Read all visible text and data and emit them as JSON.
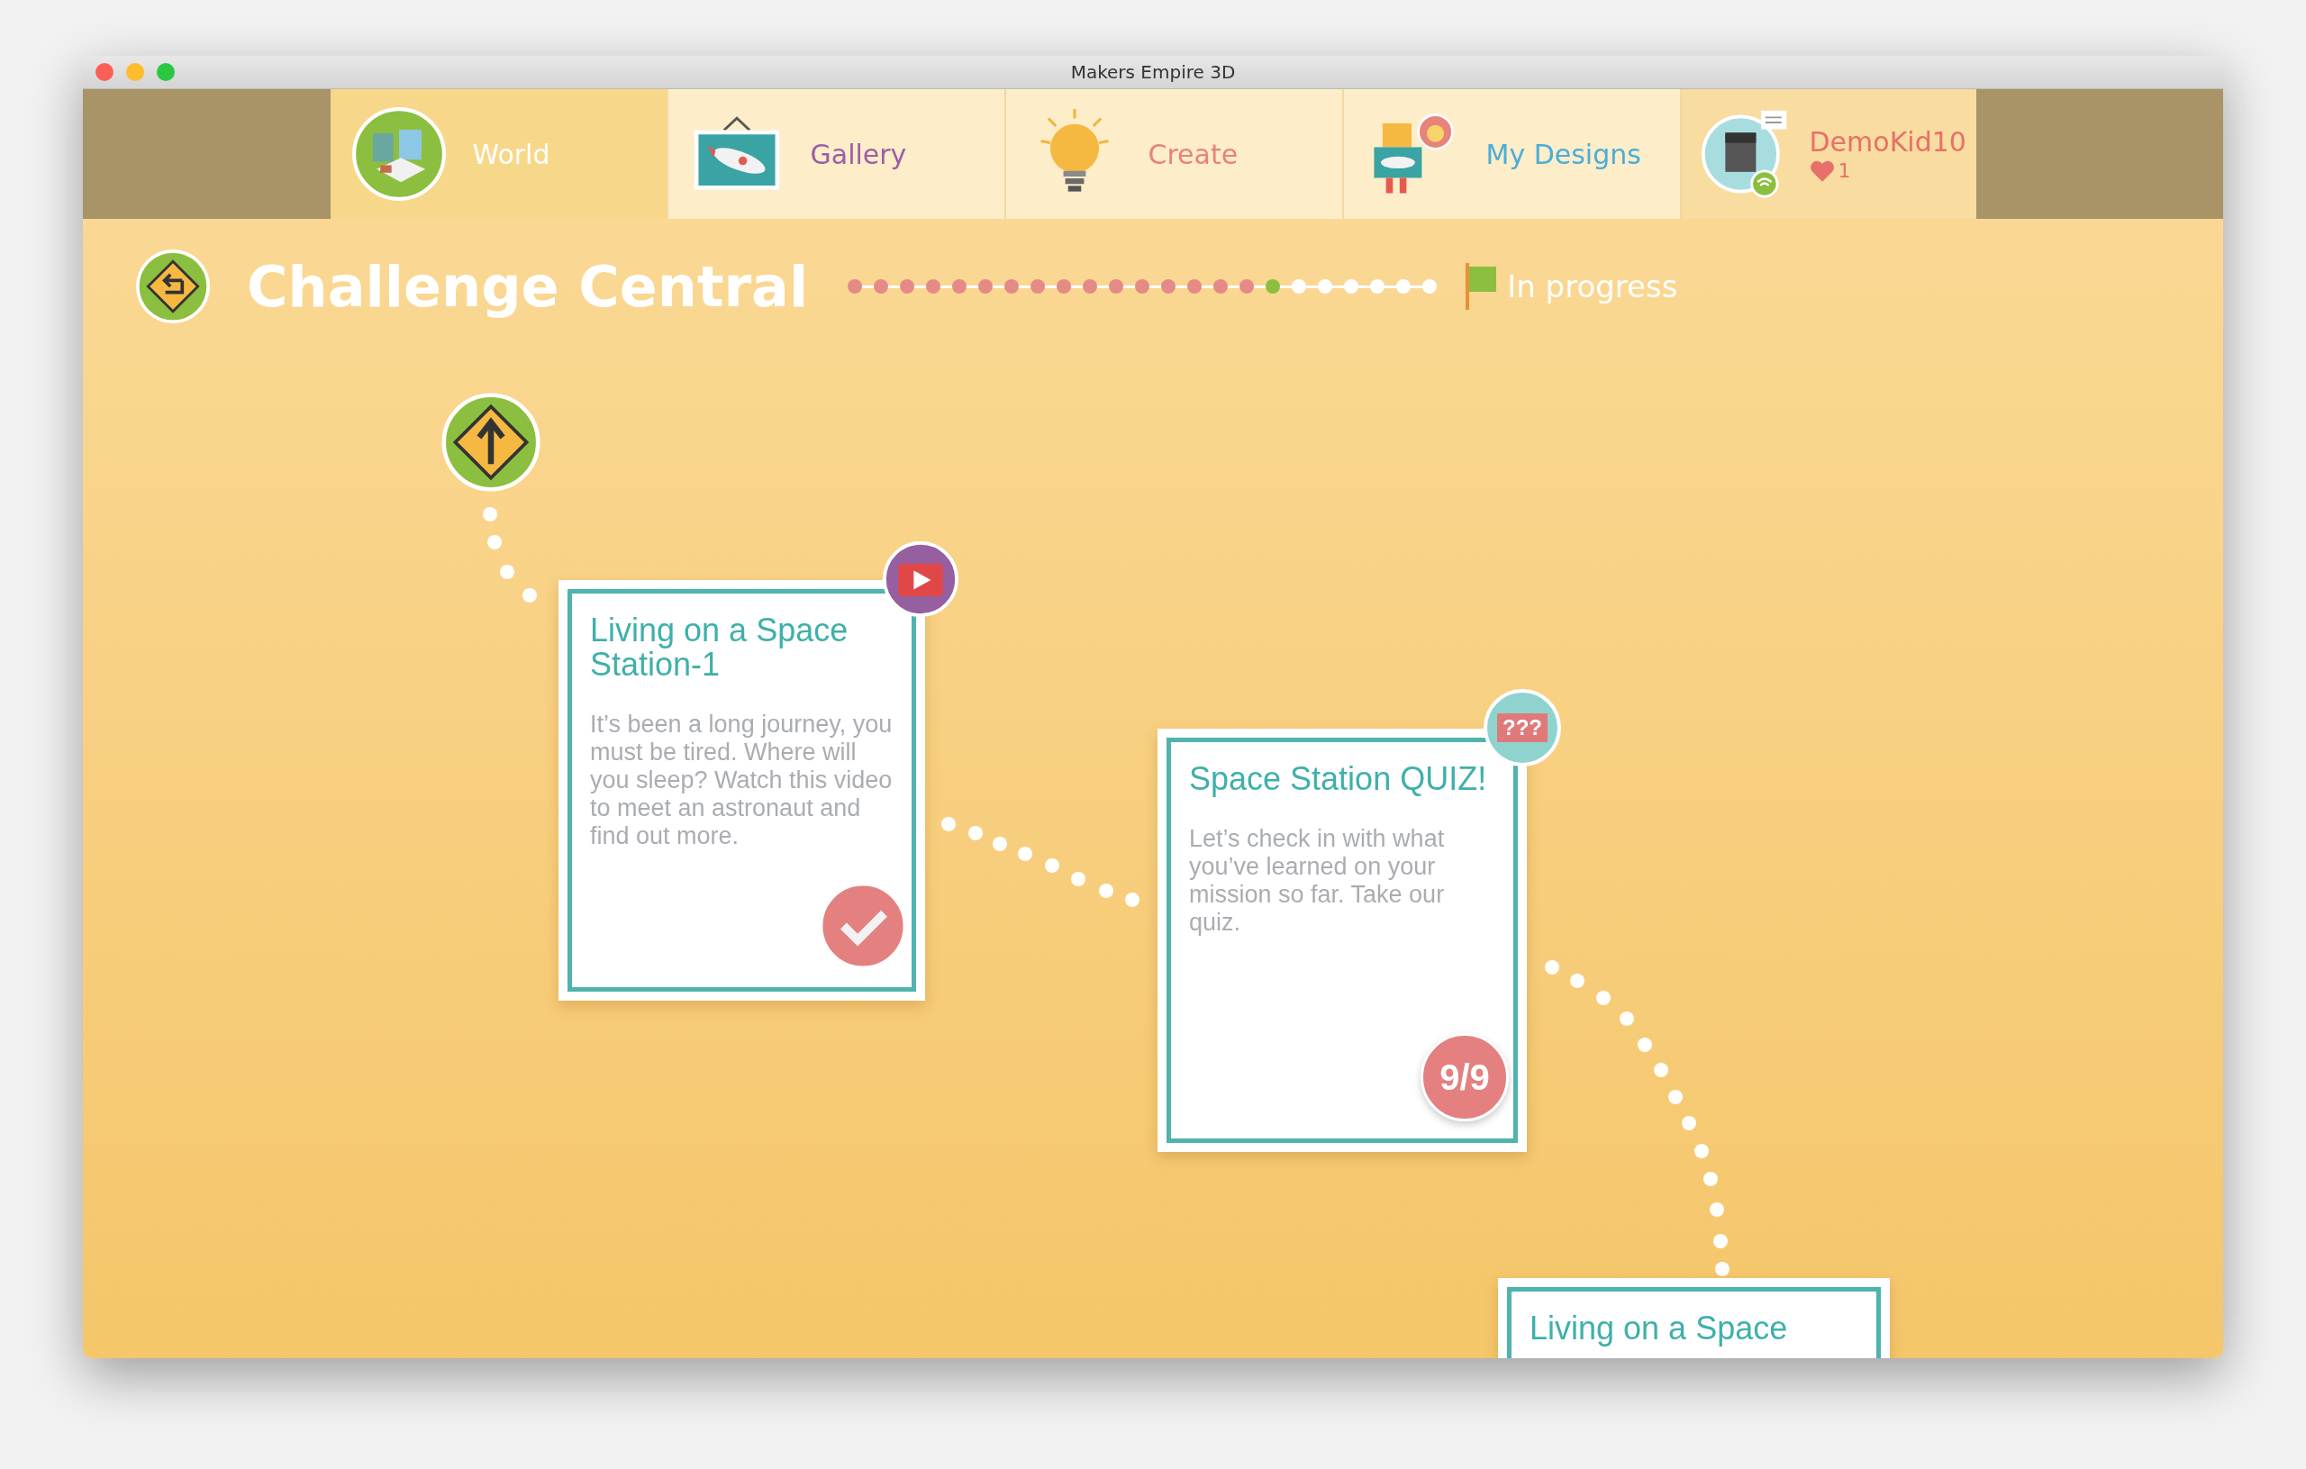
{
  "window": {
    "title": "Makers Empire 3D"
  },
  "nav_tabs": [
    {
      "kind": "world",
      "label": "World",
      "selected": true
    },
    {
      "kind": "gallery",
      "label": "Gallery",
      "selected": false
    },
    {
      "kind": "create",
      "label": "Create",
      "selected": false
    },
    {
      "kind": "designs",
      "label": "My Designs",
      "selected": false
    }
  ],
  "profile": {
    "username": "DemoKid10",
    "likes": "1"
  },
  "header": {
    "title": "Challenge Central",
    "status": "In progress",
    "progress_steps": [
      {
        "kind": "done"
      },
      {
        "kind": "done"
      },
      {
        "kind": "done"
      },
      {
        "kind": "done"
      },
      {
        "kind": "done"
      },
      {
        "kind": "done"
      },
      {
        "kind": "done"
      },
      {
        "kind": "done"
      },
      {
        "kind": "done"
      },
      {
        "kind": "done"
      },
      {
        "kind": "done"
      },
      {
        "kind": "done"
      },
      {
        "kind": "done"
      },
      {
        "kind": "done"
      },
      {
        "kind": "done"
      },
      {
        "kind": "done"
      },
      {
        "kind": "current"
      },
      {
        "kind": "todo"
      },
      {
        "kind": "todo"
      },
      {
        "kind": "todo"
      },
      {
        "kind": "todo"
      },
      {
        "kind": "todo"
      },
      {
        "kind": "todo"
      }
    ]
  },
  "cards": [
    {
      "kind": "video",
      "title": "Living on a Space Station-1",
      "description": "It’s been a long journey, you must be tired. Where will you sleep? Watch this video to meet an astronaut and find out more.",
      "completed": true
    },
    {
      "kind": "quiz",
      "badge_text": "???",
      "title": "Space Station QUIZ!",
      "description": "Let’s check in with what you’ve learned on your mission so far. Take our quiz.",
      "score": "9/9"
    },
    {
      "kind": "lesson",
      "title": "Living on a Space"
    }
  ]
}
